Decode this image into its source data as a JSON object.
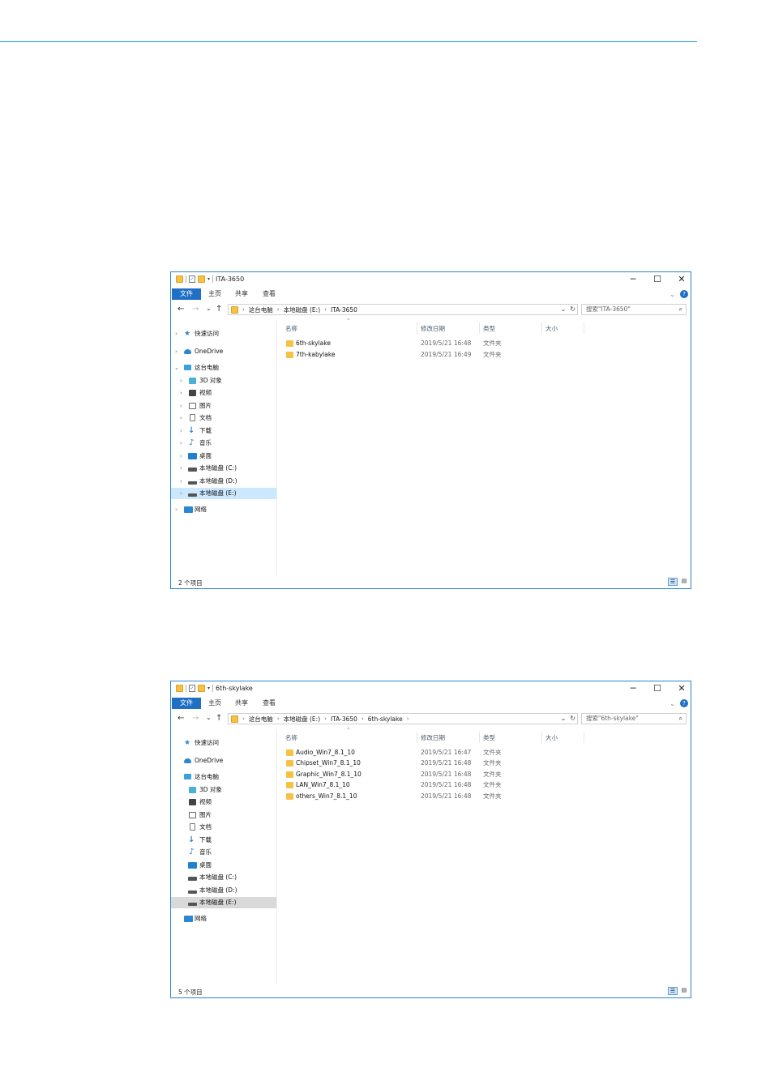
{
  "window1": {
    "title": "ITA-3650",
    "ribbon_tabs": [
      "文件",
      "主页",
      "共享",
      "查看"
    ],
    "window_controls": {
      "minimize": "─",
      "maximize": "☐",
      "close": "✕"
    },
    "nav_buttons": {
      "back": "←",
      "forward": "→",
      "recent": "⌄",
      "up": "↑"
    },
    "breadcrumb": [
      "这台电脑",
      "本地磁盘 (E:)",
      "ITA-3650"
    ],
    "search_placeholder": "搜索\"ITA-3650\"",
    "nav_pane": [
      {
        "label": "快速访问",
        "icon": "star-icon"
      },
      {
        "label": "OneDrive",
        "icon": "cloud-icon"
      },
      {
        "label": "这台电脑",
        "icon": "computer-icon"
      },
      {
        "label": "3D 对象",
        "icon": "cube-icon"
      },
      {
        "label": "视频",
        "icon": "video-icon"
      },
      {
        "label": "图片",
        "icon": "picture-icon"
      },
      {
        "label": "文档",
        "icon": "document-icon"
      },
      {
        "label": "下载",
        "icon": "download-icon"
      },
      {
        "label": "音乐",
        "icon": "music-icon"
      },
      {
        "label": "桌面",
        "icon": "desktop-icon"
      },
      {
        "label": "本地磁盘 (C:)",
        "icon": "drive-icon"
      },
      {
        "label": "本地磁盘 (D:)",
        "icon": "drive-icon"
      },
      {
        "label": "本地磁盘 (E:)",
        "icon": "drive-icon"
      },
      {
        "label": "网络",
        "icon": "network-icon"
      }
    ],
    "columns": [
      "名称",
      "修改日期",
      "类型",
      "大小"
    ],
    "files": [
      {
        "name": "6th-skylake",
        "date": "2019/5/21 16:48",
        "type": "文件夹"
      },
      {
        "name": "7th-kabylake",
        "date": "2019/5/21 16:49",
        "type": "文件夹"
      }
    ],
    "status": "2 个项目"
  },
  "window2": {
    "title": "6th-skylake",
    "ribbon_tabs": [
      "文件",
      "主页",
      "共享",
      "查看"
    ],
    "window_controls": {
      "minimize": "─",
      "maximize": "☐",
      "close": "✕"
    },
    "nav_buttons": {
      "back": "←",
      "forward": "→",
      "recent": "⌄",
      "up": "↑"
    },
    "breadcrumb": [
      "这台电脑",
      "本地磁盘 (E:)",
      "ITA-3650",
      "6th-skylake"
    ],
    "search_placeholder": "搜索\"6th-skylake\"",
    "nav_pane": [
      {
        "label": "快速访问",
        "icon": "star-icon"
      },
      {
        "label": "OneDrive",
        "icon": "cloud-icon"
      },
      {
        "label": "这台电脑",
        "icon": "computer-icon"
      },
      {
        "label": "3D 对象",
        "icon": "cube-icon"
      },
      {
        "label": "视频",
        "icon": "video-icon"
      },
      {
        "label": "图片",
        "icon": "picture-icon"
      },
      {
        "label": "文档",
        "icon": "document-icon"
      },
      {
        "label": "下载",
        "icon": "download-icon"
      },
      {
        "label": "音乐",
        "icon": "music-icon"
      },
      {
        "label": "桌面",
        "icon": "desktop-icon"
      },
      {
        "label": "本地磁盘 (C:)",
        "icon": "drive-icon"
      },
      {
        "label": "本地磁盘 (D:)",
        "icon": "drive-icon"
      },
      {
        "label": "本地磁盘 (E:)",
        "icon": "drive-icon"
      },
      {
        "label": "网络",
        "icon": "network-icon"
      }
    ],
    "columns": [
      "名称",
      "修改日期",
      "类型",
      "大小"
    ],
    "files": [
      {
        "name": "Audio_Win7_8.1_10",
        "date": "2019/5/21 16:47",
        "type": "文件夹"
      },
      {
        "name": "Chipset_Win7_8.1_10",
        "date": "2019/5/21 16:48",
        "type": "文件夹"
      },
      {
        "name": "Graphic_Win7_8.1_10",
        "date": "2019/5/21 16:48",
        "type": "文件夹"
      },
      {
        "name": "LAN_Win7_8.1_10",
        "date": "2019/5/21 16:48",
        "type": "文件夹"
      },
      {
        "name": "others_Win7_8.1_10",
        "date": "2019/5/21 16:48",
        "type": "文件夹"
      }
    ],
    "status": "5 个项目"
  },
  "colors": {
    "accent": "#1f6fc5",
    "rule": "#19a0d6",
    "folder": "#f6c244",
    "selection": "#cce8ff"
  }
}
